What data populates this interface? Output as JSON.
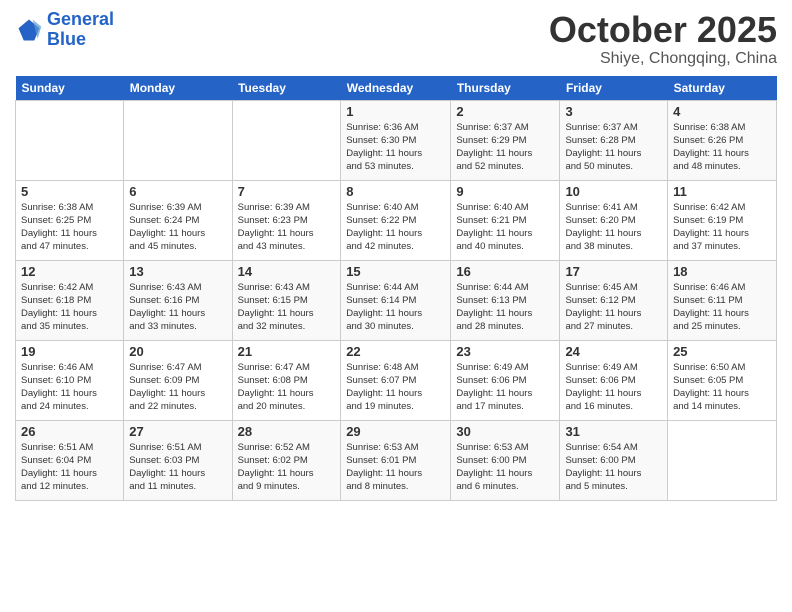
{
  "header": {
    "logo_line1": "General",
    "logo_line2": "Blue",
    "title": "October 2025",
    "subtitle": "Shiye, Chongqing, China"
  },
  "weekdays": [
    "Sunday",
    "Monday",
    "Tuesday",
    "Wednesday",
    "Thursday",
    "Friday",
    "Saturday"
  ],
  "weeks": [
    [
      {
        "day": "",
        "info": ""
      },
      {
        "day": "",
        "info": ""
      },
      {
        "day": "",
        "info": ""
      },
      {
        "day": "1",
        "info": "Sunrise: 6:36 AM\nSunset: 6:30 PM\nDaylight: 11 hours\nand 53 minutes."
      },
      {
        "day": "2",
        "info": "Sunrise: 6:37 AM\nSunset: 6:29 PM\nDaylight: 11 hours\nand 52 minutes."
      },
      {
        "day": "3",
        "info": "Sunrise: 6:37 AM\nSunset: 6:28 PM\nDaylight: 11 hours\nand 50 minutes."
      },
      {
        "day": "4",
        "info": "Sunrise: 6:38 AM\nSunset: 6:26 PM\nDaylight: 11 hours\nand 48 minutes."
      }
    ],
    [
      {
        "day": "5",
        "info": "Sunrise: 6:38 AM\nSunset: 6:25 PM\nDaylight: 11 hours\nand 47 minutes."
      },
      {
        "day": "6",
        "info": "Sunrise: 6:39 AM\nSunset: 6:24 PM\nDaylight: 11 hours\nand 45 minutes."
      },
      {
        "day": "7",
        "info": "Sunrise: 6:39 AM\nSunset: 6:23 PM\nDaylight: 11 hours\nand 43 minutes."
      },
      {
        "day": "8",
        "info": "Sunrise: 6:40 AM\nSunset: 6:22 PM\nDaylight: 11 hours\nand 42 minutes."
      },
      {
        "day": "9",
        "info": "Sunrise: 6:40 AM\nSunset: 6:21 PM\nDaylight: 11 hours\nand 40 minutes."
      },
      {
        "day": "10",
        "info": "Sunrise: 6:41 AM\nSunset: 6:20 PM\nDaylight: 11 hours\nand 38 minutes."
      },
      {
        "day": "11",
        "info": "Sunrise: 6:42 AM\nSunset: 6:19 PM\nDaylight: 11 hours\nand 37 minutes."
      }
    ],
    [
      {
        "day": "12",
        "info": "Sunrise: 6:42 AM\nSunset: 6:18 PM\nDaylight: 11 hours\nand 35 minutes."
      },
      {
        "day": "13",
        "info": "Sunrise: 6:43 AM\nSunset: 6:16 PM\nDaylight: 11 hours\nand 33 minutes."
      },
      {
        "day": "14",
        "info": "Sunrise: 6:43 AM\nSunset: 6:15 PM\nDaylight: 11 hours\nand 32 minutes."
      },
      {
        "day": "15",
        "info": "Sunrise: 6:44 AM\nSunset: 6:14 PM\nDaylight: 11 hours\nand 30 minutes."
      },
      {
        "day": "16",
        "info": "Sunrise: 6:44 AM\nSunset: 6:13 PM\nDaylight: 11 hours\nand 28 minutes."
      },
      {
        "day": "17",
        "info": "Sunrise: 6:45 AM\nSunset: 6:12 PM\nDaylight: 11 hours\nand 27 minutes."
      },
      {
        "day": "18",
        "info": "Sunrise: 6:46 AM\nSunset: 6:11 PM\nDaylight: 11 hours\nand 25 minutes."
      }
    ],
    [
      {
        "day": "19",
        "info": "Sunrise: 6:46 AM\nSunset: 6:10 PM\nDaylight: 11 hours\nand 24 minutes."
      },
      {
        "day": "20",
        "info": "Sunrise: 6:47 AM\nSunset: 6:09 PM\nDaylight: 11 hours\nand 22 minutes."
      },
      {
        "day": "21",
        "info": "Sunrise: 6:47 AM\nSunset: 6:08 PM\nDaylight: 11 hours\nand 20 minutes."
      },
      {
        "day": "22",
        "info": "Sunrise: 6:48 AM\nSunset: 6:07 PM\nDaylight: 11 hours\nand 19 minutes."
      },
      {
        "day": "23",
        "info": "Sunrise: 6:49 AM\nSunset: 6:06 PM\nDaylight: 11 hours\nand 17 minutes."
      },
      {
        "day": "24",
        "info": "Sunrise: 6:49 AM\nSunset: 6:06 PM\nDaylight: 11 hours\nand 16 minutes."
      },
      {
        "day": "25",
        "info": "Sunrise: 6:50 AM\nSunset: 6:05 PM\nDaylight: 11 hours\nand 14 minutes."
      }
    ],
    [
      {
        "day": "26",
        "info": "Sunrise: 6:51 AM\nSunset: 6:04 PM\nDaylight: 11 hours\nand 12 minutes."
      },
      {
        "day": "27",
        "info": "Sunrise: 6:51 AM\nSunset: 6:03 PM\nDaylight: 11 hours\nand 11 minutes."
      },
      {
        "day": "28",
        "info": "Sunrise: 6:52 AM\nSunset: 6:02 PM\nDaylight: 11 hours\nand 9 minutes."
      },
      {
        "day": "29",
        "info": "Sunrise: 6:53 AM\nSunset: 6:01 PM\nDaylight: 11 hours\nand 8 minutes."
      },
      {
        "day": "30",
        "info": "Sunrise: 6:53 AM\nSunset: 6:00 PM\nDaylight: 11 hours\nand 6 minutes."
      },
      {
        "day": "31",
        "info": "Sunrise: 6:54 AM\nSunset: 6:00 PM\nDaylight: 11 hours\nand 5 minutes."
      },
      {
        "day": "",
        "info": ""
      }
    ]
  ]
}
